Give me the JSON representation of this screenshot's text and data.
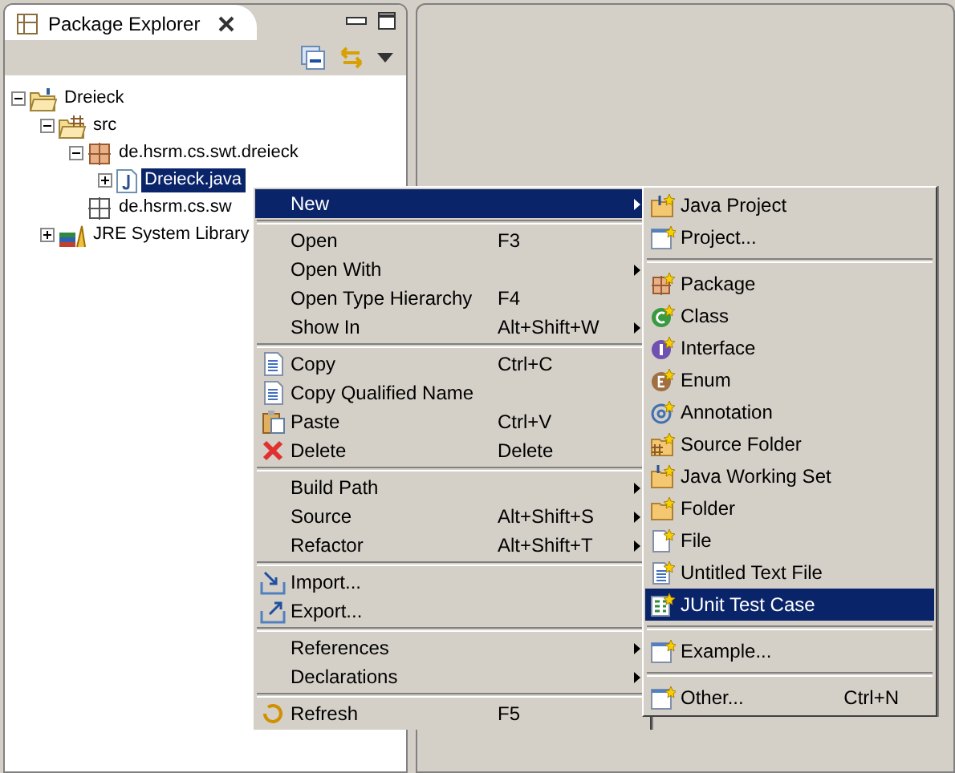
{
  "view": {
    "title": "Package Explorer"
  },
  "tree": [
    {
      "label": "Dreieck",
      "expanded": true,
      "selected": false,
      "children": [
        {
          "label": "src",
          "expanded": true,
          "selected": false,
          "children": [
            {
              "label": "de.hsrm.cs.swt.dreieck",
              "expanded": true,
              "selected": false,
              "children": [
                {
                  "label": "Dreieck.java",
                  "expanded": false,
                  "selected": true
                }
              ]
            },
            {
              "label": "de.hsrm.cs.sw",
              "selected": false
            }
          ]
        },
        {
          "label": "JRE System Library",
          "expanded": false,
          "selected": false
        }
      ]
    }
  ],
  "context_menu": [
    {
      "kind": "item",
      "label": "New",
      "submenu": true,
      "selected": true
    },
    {
      "kind": "separator"
    },
    {
      "kind": "item",
      "label": "Open",
      "shortcut": "F3",
      "selected": false
    },
    {
      "kind": "item",
      "label": "Open With",
      "submenu": true,
      "selected": false
    },
    {
      "kind": "item",
      "label": "Open Type Hierarchy",
      "shortcut": "F4",
      "selected": false
    },
    {
      "kind": "item",
      "label": "Show In",
      "shortcut": "Alt+Shift+W",
      "submenu": true,
      "selected": false
    },
    {
      "kind": "separator"
    },
    {
      "kind": "item",
      "label": "Copy",
      "shortcut": "Ctrl+C",
      "selected": false
    },
    {
      "kind": "item",
      "label": "Copy Qualified Name",
      "selected": false
    },
    {
      "kind": "item",
      "label": "Paste",
      "shortcut": "Ctrl+V",
      "selected": false
    },
    {
      "kind": "item",
      "label": "Delete",
      "shortcut": "Delete",
      "selected": false
    },
    {
      "kind": "separator"
    },
    {
      "kind": "item",
      "label": "Build Path",
      "submenu": true,
      "selected": false
    },
    {
      "kind": "item",
      "label": "Source",
      "shortcut": "Alt+Shift+S",
      "submenu": true,
      "selected": false
    },
    {
      "kind": "item",
      "label": "Refactor",
      "shortcut": "Alt+Shift+T",
      "submenu": true,
      "selected": false
    },
    {
      "kind": "separator"
    },
    {
      "kind": "item",
      "label": "Import...",
      "selected": false
    },
    {
      "kind": "item",
      "label": "Export...",
      "selected": false
    },
    {
      "kind": "separator"
    },
    {
      "kind": "item",
      "label": "References",
      "submenu": true,
      "selected": false
    },
    {
      "kind": "item",
      "label": "Declarations",
      "submenu": true,
      "selected": false
    },
    {
      "kind": "separator"
    },
    {
      "kind": "item",
      "label": "Refresh",
      "shortcut": "F5",
      "selected": false
    }
  ],
  "new_submenu": [
    {
      "kind": "item",
      "label": "Java Project",
      "selected": false
    },
    {
      "kind": "item",
      "label": "Project...",
      "selected": false
    },
    {
      "kind": "separator"
    },
    {
      "kind": "item",
      "label": "Package",
      "selected": false
    },
    {
      "kind": "item",
      "label": "Class",
      "selected": false
    },
    {
      "kind": "item",
      "label": "Interface",
      "selected": false
    },
    {
      "kind": "item",
      "label": "Enum",
      "selected": false
    },
    {
      "kind": "item",
      "label": "Annotation",
      "selected": false
    },
    {
      "kind": "item",
      "label": "Source Folder",
      "selected": false
    },
    {
      "kind": "item",
      "label": "Java Working Set",
      "selected": false
    },
    {
      "kind": "item",
      "label": "Folder",
      "selected": false
    },
    {
      "kind": "item",
      "label": "File",
      "selected": false
    },
    {
      "kind": "item",
      "label": "Untitled Text File",
      "selected": false
    },
    {
      "kind": "item",
      "label": "JUnit Test Case",
      "selected": true
    },
    {
      "kind": "separator"
    },
    {
      "kind": "item",
      "label": "Example...",
      "selected": false
    },
    {
      "kind": "separator"
    },
    {
      "kind": "item",
      "label": "Other...",
      "shortcut": "Ctrl+N",
      "selected": false
    }
  ]
}
